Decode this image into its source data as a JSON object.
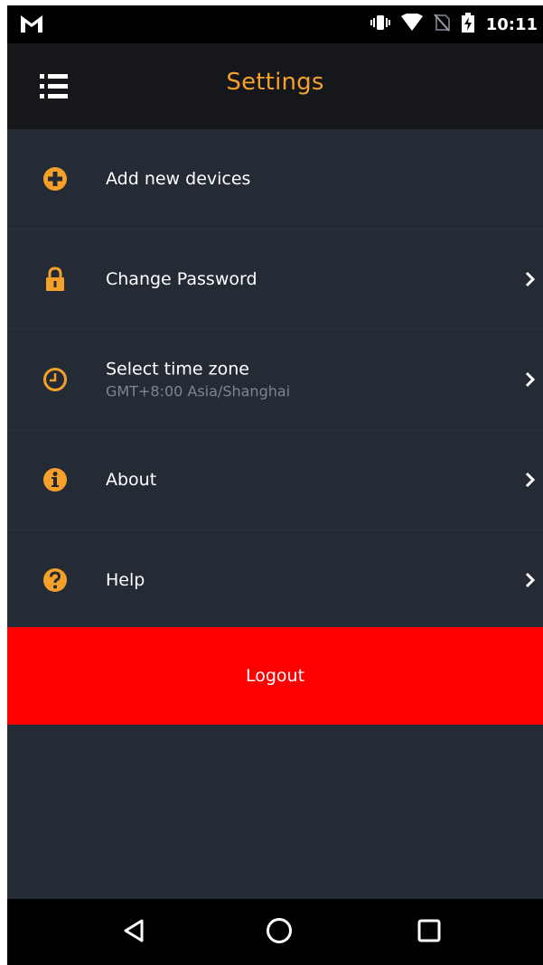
{
  "status_bar": {
    "time": "10:11",
    "icons": [
      "gmail-icon",
      "vibrate-icon",
      "wifi-icon",
      "no-sim-icon",
      "battery-charging-icon"
    ]
  },
  "app_bar": {
    "title": "Settings",
    "menu_icon": "list-menu-icon"
  },
  "settings": {
    "items": [
      {
        "label": "Add new devices",
        "icon": "add-circle-icon",
        "has_chevron": false
      },
      {
        "label": "Change Password",
        "icon": "lock-icon",
        "has_chevron": true
      },
      {
        "label": "Select time zone",
        "sublabel": "GMT+8:00 Asia/Shanghai",
        "icon": "clock-icon",
        "has_chevron": true
      },
      {
        "label": "About",
        "icon": "info-icon",
        "has_chevron": true
      },
      {
        "label": "Help",
        "icon": "help-icon",
        "has_chevron": true
      }
    ]
  },
  "logout": {
    "label": "Logout"
  },
  "nav_bar": {
    "buttons": [
      "back-icon",
      "home-icon",
      "recents-icon"
    ]
  },
  "colors": {
    "accent": "#f5a02a",
    "background": "#252b34",
    "app_bar": "#15171a",
    "logout": "#ff0000",
    "status_bar": "#000000"
  }
}
